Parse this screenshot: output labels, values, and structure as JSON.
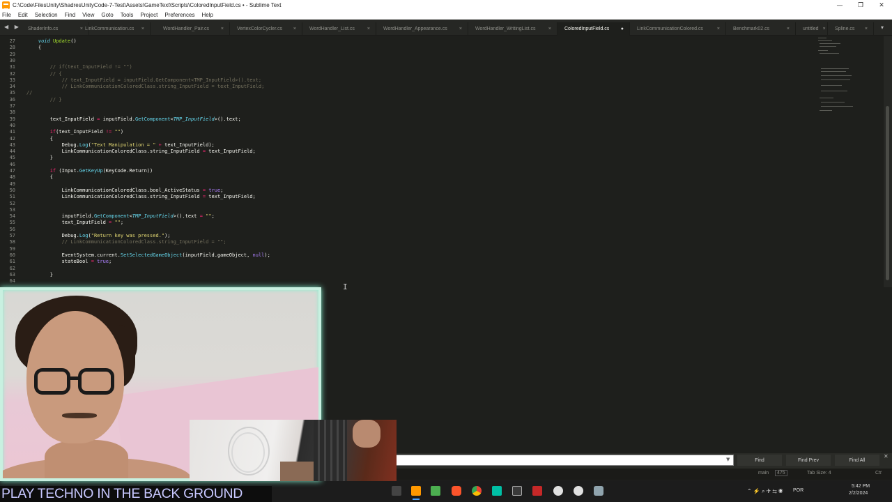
{
  "window": {
    "title": "C:\\Code\\FilesUnity\\ShadresUnityCode-7-Test\\Assets\\GameText\\Scripts\\ColoredInputField.cs • - Sublime Text",
    "controls": [
      "—",
      "❐",
      "✕"
    ]
  },
  "menu": [
    "File",
    "Edit",
    "Selection",
    "Find",
    "View",
    "Goto",
    "Tools",
    "Project",
    "Preferences",
    "Help"
  ],
  "tabs": [
    {
      "label": "ShaderInfo.cs",
      "close": "×"
    },
    {
      "label": "LinkCommunication.cs",
      "close": "×"
    },
    {
      "label": "WordHandler_Pair.cs",
      "close": "×"
    },
    {
      "label": "VertexColorCycler.cs",
      "close": "×"
    },
    {
      "label": "WordHandler_List.cs",
      "close": "×"
    },
    {
      "label": "WordHandler_Appearance.cs",
      "close": "×"
    },
    {
      "label": "WordHandler_WritingList.cs",
      "close": "×"
    },
    {
      "label": "ColoredInputField.cs",
      "close": "●"
    },
    {
      "label": "LinkCommunicationColored.cs",
      "close": "×"
    },
    {
      "label": "Benchmark02.cs",
      "close": "×"
    },
    {
      "label": "untitled",
      "close": "×"
    },
    {
      "label": "Spline.cs",
      "close": "×"
    }
  ],
  "tab_nav": "◀ ▶",
  "tab_menu": "▾",
  "code_lines": [
    {
      "n": "27",
      "tokens": [
        [
          "",
          "    "
        ],
        [
          "c-ty",
          "void"
        ],
        [
          "",
          " "
        ],
        [
          "c-fn",
          "Update"
        ],
        [
          "",
          "()"
        ]
      ]
    },
    {
      "n": "28",
      "tokens": [
        [
          "",
          "    {"
        ]
      ]
    },
    {
      "n": "29",
      "tokens": []
    },
    {
      "n": "30",
      "tokens": []
    },
    {
      "n": "31",
      "tokens": [
        [
          "c-cm",
          "        // if(text_InputField != \"\")"
        ]
      ]
    },
    {
      "n": "32",
      "tokens": [
        [
          "c-cm",
          "        // {"
        ]
      ]
    },
    {
      "n": "33",
      "tokens": [
        [
          "c-cm",
          "            // text_InputField = inputField.GetComponent<TMP_InputField>().text;"
        ]
      ]
    },
    {
      "n": "34",
      "tokens": [
        [
          "c-cm",
          "            // LinkCommunicationColoredClass.string_InputField = text_InputField;"
        ]
      ]
    },
    {
      "n": "35",
      "tokens": [
        [
          "c-cm",
          "//"
        ]
      ]
    },
    {
      "n": "36",
      "tokens": [
        [
          "c-cm",
          "        // }"
        ]
      ]
    },
    {
      "n": "37",
      "tokens": []
    },
    {
      "n": "38",
      "tokens": []
    },
    {
      "n": "39",
      "tokens": [
        [
          "",
          "        text_InputField "
        ],
        [
          "c-kw",
          "="
        ],
        [
          "",
          " inputField."
        ],
        [
          "c-call",
          "GetComponent"
        ],
        [
          "",
          "<"
        ],
        [
          "c-ty",
          "TMP_InputField"
        ],
        [
          "",
          ">().text;"
        ]
      ]
    },
    {
      "n": "40",
      "tokens": []
    },
    {
      "n": "41",
      "tokens": [
        [
          "",
          "        "
        ],
        [
          "c-kw",
          "if"
        ],
        [
          "",
          "(text_InputField "
        ],
        [
          "c-kw",
          "!="
        ],
        [
          "",
          " "
        ],
        [
          "c-str",
          "\"\""
        ],
        [
          "",
          ")"
        ]
      ]
    },
    {
      "n": "42",
      "tokens": [
        [
          "",
          "        {"
        ]
      ]
    },
    {
      "n": "43",
      "tokens": [
        [
          "",
          "            Debug."
        ],
        [
          "c-call",
          "Log"
        ],
        [
          "",
          "("
        ],
        [
          "c-str",
          "\"Text Manipulation = \""
        ],
        [
          "",
          " "
        ],
        [
          "c-kw",
          "+"
        ],
        [
          "",
          " text_InputField);"
        ]
      ]
    },
    {
      "n": "44",
      "tokens": [
        [
          "",
          "            LinkCommunicationColoredClass.string_InputField "
        ],
        [
          "c-kw",
          "="
        ],
        [
          "",
          " text_InputField;"
        ]
      ]
    },
    {
      "n": "45",
      "tokens": [
        [
          "",
          "        }"
        ]
      ]
    },
    {
      "n": "46",
      "tokens": []
    },
    {
      "n": "47",
      "tokens": [
        [
          "",
          "        "
        ],
        [
          "c-kw",
          "if"
        ],
        [
          "",
          " (Input."
        ],
        [
          "c-call",
          "GetKeyUp"
        ],
        [
          "",
          "(KeyCode.Return))"
        ]
      ]
    },
    {
      "n": "48",
      "tokens": [
        [
          "",
          "        {"
        ]
      ]
    },
    {
      "n": "49",
      "tokens": []
    },
    {
      "n": "50",
      "tokens": [
        [
          "",
          "            LinkCommunicationColoredClass.bool_ActiveStatus "
        ],
        [
          "c-kw",
          "="
        ],
        [
          "",
          " "
        ],
        [
          "c-pur",
          "true"
        ],
        [
          "",
          ";"
        ]
      ]
    },
    {
      "n": "51",
      "tokens": [
        [
          "",
          "            LinkCommunicationColoredClass.string_InputField "
        ],
        [
          "c-kw",
          "="
        ],
        [
          "",
          " text_InputField;"
        ]
      ]
    },
    {
      "n": "52",
      "tokens": []
    },
    {
      "n": "53",
      "tokens": []
    },
    {
      "n": "54",
      "tokens": [
        [
          "",
          "            inputField."
        ],
        [
          "c-call",
          "GetComponent"
        ],
        [
          "",
          "<"
        ],
        [
          "c-ty",
          "TMP_InputField"
        ],
        [
          "",
          ">().text "
        ],
        [
          "c-kw",
          "="
        ],
        [
          "",
          " "
        ],
        [
          "c-str",
          "\"\""
        ],
        [
          "",
          ";"
        ]
      ]
    },
    {
      "n": "55",
      "tokens": [
        [
          "",
          "            text_InputField "
        ],
        [
          "c-kw",
          "="
        ],
        [
          "",
          " "
        ],
        [
          "c-str",
          "\"\""
        ],
        [
          "",
          ";"
        ]
      ]
    },
    {
      "n": "56",
      "tokens": []
    },
    {
      "n": "57",
      "tokens": [
        [
          "",
          "            Debug."
        ],
        [
          "c-call",
          "Log"
        ],
        [
          "",
          "("
        ],
        [
          "c-str",
          "\"Return key was pressed.\""
        ],
        [
          "",
          ");"
        ]
      ]
    },
    {
      "n": "58",
      "tokens": [
        [
          "c-cm",
          "            // LinkCommunicationColoredClass.string_InputField = \"\";"
        ]
      ]
    },
    {
      "n": "59",
      "tokens": []
    },
    {
      "n": "60",
      "tokens": [
        [
          "",
          "            EventSystem.current."
        ],
        [
          "c-call",
          "SetSelectedGameObject"
        ],
        [
          "",
          "(inputField.gameObject, "
        ],
        [
          "c-pur",
          "null"
        ],
        [
          "",
          ");"
        ]
      ]
    },
    {
      "n": "61",
      "tokens": [
        [
          "",
          "            stateBool "
        ],
        [
          "c-kw",
          "="
        ],
        [
          "",
          " "
        ],
        [
          "c-pur",
          "true"
        ],
        [
          "",
          ";"
        ]
      ]
    },
    {
      "n": "62",
      "tokens": []
    },
    {
      "n": "63",
      "tokens": [
        [
          "",
          "        }"
        ]
      ]
    },
    {
      "n": "64",
      "tokens": []
    }
  ],
  "find_panel": {
    "input_value": "",
    "dropdown_icon": "▼",
    "buttons": {
      "find": "Find",
      "find_prev": "Find Prev",
      "find_all": "Find All"
    },
    "close": "✕"
  },
  "status_bar": {
    "branch": "main",
    "branch_count": "475",
    "tab_size": "Tab Size: 4",
    "syntax": "C#"
  },
  "taskbar": {
    "language": "POR",
    "time": "5:42 PM",
    "date": "2/2/2024",
    "tray_icons": "⌃  ⚡  ⌕  ✈  ⇆  ◉"
  },
  "overlay": {
    "banner_text": "PLAY TECHNO IN THE BACK GROUND"
  },
  "colors": {
    "accent": "#4da3ff",
    "editor_bg": "#1e1f1c",
    "banner_text": "#c8c8ff",
    "webcam_border": "#c8f0e0"
  }
}
